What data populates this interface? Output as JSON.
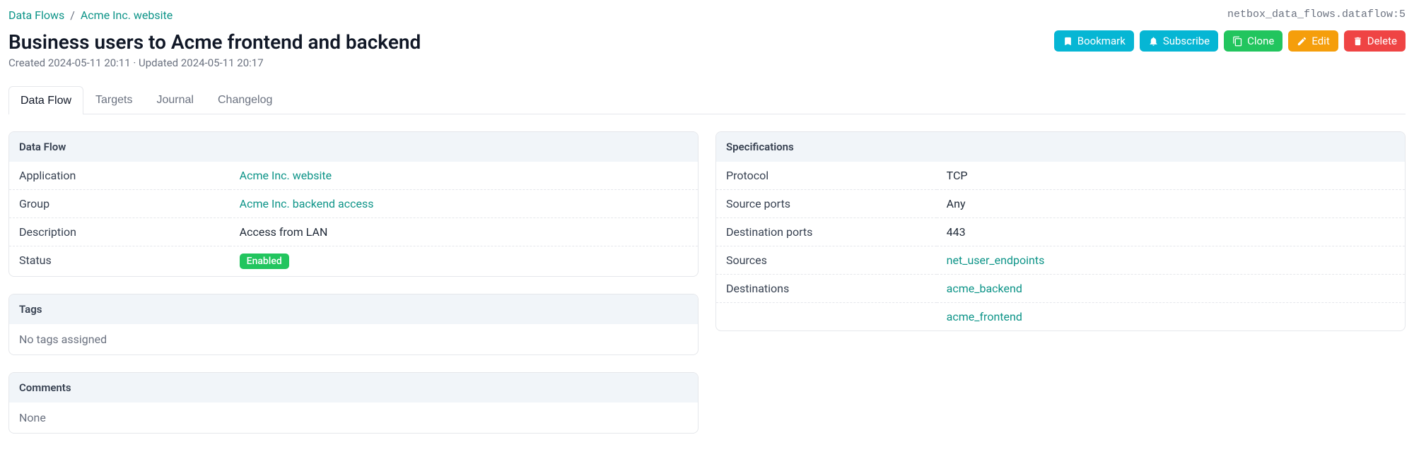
{
  "breadcrumb": {
    "root": "Data Flows",
    "parent": "Acme Inc. website"
  },
  "identifier": "netbox_data_flows.dataflow:5",
  "title": "Business users to Acme frontend and backend",
  "meta": "Created 2024-05-11 20:11 · Updated 2024-05-11 20:17",
  "actions": {
    "bookmark": "Bookmark",
    "subscribe": "Subscribe",
    "clone": "Clone",
    "edit": "Edit",
    "delete": "Delete"
  },
  "tabs": {
    "dataflow": "Data Flow",
    "targets": "Targets",
    "journal": "Journal",
    "changelog": "Changelog"
  },
  "cards": {
    "dataflow": {
      "header": "Data Flow",
      "application_label": "Application",
      "application_value": "Acme Inc. website",
      "group_label": "Group",
      "group_value": "Acme Inc. backend access",
      "description_label": "Description",
      "description_value": "Access from LAN",
      "status_label": "Status",
      "status_value": "Enabled"
    },
    "tags": {
      "header": "Tags",
      "body": "No tags assigned"
    },
    "comments": {
      "header": "Comments",
      "body": "None"
    },
    "specs": {
      "header": "Specifications",
      "protocol_label": "Protocol",
      "protocol_value": "TCP",
      "srcports_label": "Source ports",
      "srcports_value": "Any",
      "dstports_label": "Destination ports",
      "dstports_value": "443",
      "sources_label": "Sources",
      "sources_value": "net_user_endpoints",
      "destinations_label": "Destinations",
      "destinations_value1": "acme_backend",
      "destinations_value2": "acme_frontend"
    }
  }
}
